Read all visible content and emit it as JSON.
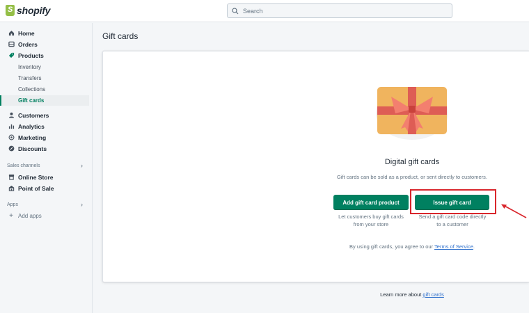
{
  "topbar": {
    "brand": "shopify",
    "search_placeholder": "Search"
  },
  "sidebar": {
    "items": [
      {
        "label": "Home",
        "icon": "home-icon"
      },
      {
        "label": "Orders",
        "icon": "orders-icon"
      },
      {
        "label": "Products",
        "icon": "tag-icon"
      }
    ],
    "product_subitems": [
      "Inventory",
      "Transfers",
      "Collections",
      "Gift cards"
    ],
    "more_items": [
      {
        "label": "Customers",
        "icon": "person-icon"
      },
      {
        "label": "Analytics",
        "icon": "bar-chart-icon"
      },
      {
        "label": "Marketing",
        "icon": "target-icon"
      },
      {
        "label": "Discounts",
        "icon": "discount-icon"
      }
    ],
    "sales_channels_label": "Sales channels",
    "channels": [
      {
        "label": "Online Store",
        "icon": "store-icon"
      },
      {
        "label": "Point of Sale",
        "icon": "pos-icon"
      }
    ],
    "apps_label": "Apps",
    "add_apps_label": "Add apps"
  },
  "main": {
    "page_title": "Gift cards",
    "empty_state": {
      "title": "Digital gift cards",
      "description": "Gift cards can be sold as a product, or sent directly to customers.",
      "add_button": "Add gift card product",
      "add_caption_1": "Let customers buy gift cards",
      "add_caption_2": "from your store",
      "issue_button": "Issue gift card",
      "issue_caption_1": "Send a gift card code directly",
      "issue_caption_2": "to a customer",
      "tos_prefix": "By using gift cards, you agree to our ",
      "tos_link": "Terms of Service",
      "tos_suffix": "."
    },
    "footer": {
      "learn_prefix": "Learn more about ",
      "learn_link": "gift cards"
    }
  },
  "colors": {
    "primary": "#008060",
    "highlight": "#d9262c",
    "link": "#2c6ecb",
    "gift_card": "#f0b45e",
    "ribbon": "#de5d55"
  }
}
